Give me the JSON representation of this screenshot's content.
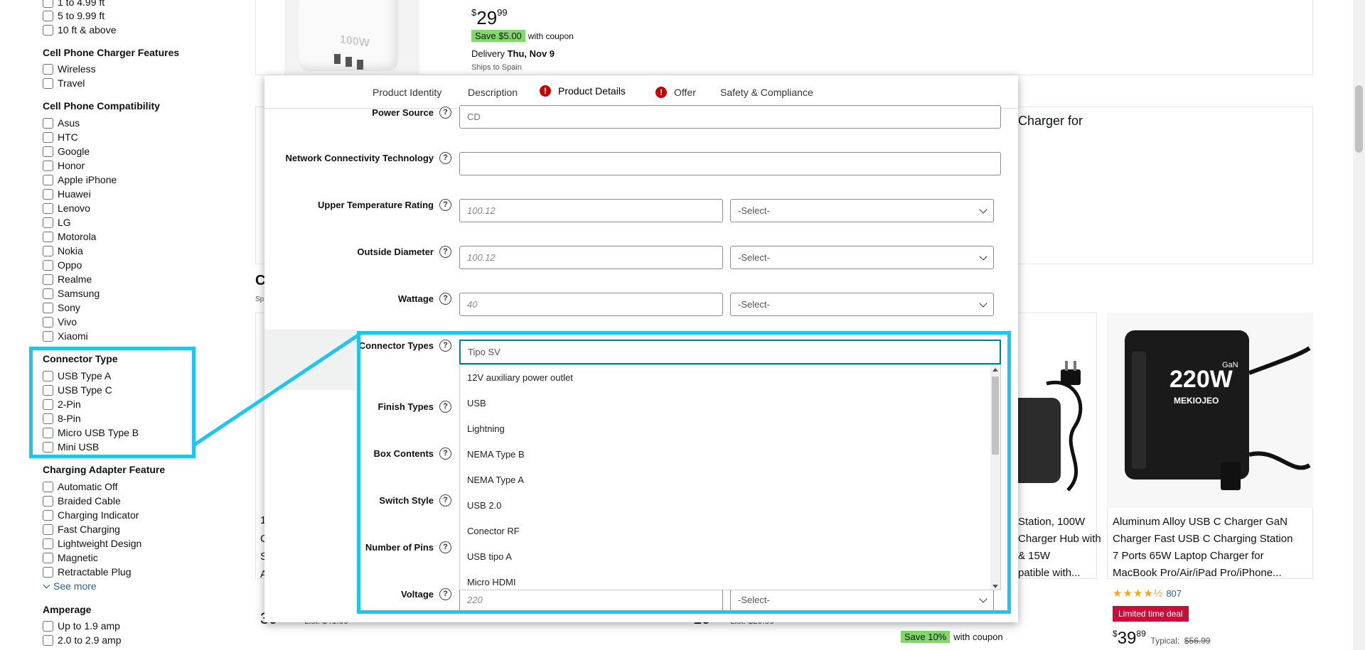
{
  "sidebar": {
    "length_options": [
      "1 to 4.99 ft",
      "5 to 9.99 ft",
      "10 ft & above"
    ],
    "features_heading": "Cell Phone Charger Features",
    "features": [
      "Wireless",
      "Travel"
    ],
    "compat_heading": "Cell Phone Compatibility",
    "compat": [
      "Asus",
      "HTC",
      "Google",
      "Honor",
      "Apple iPhone",
      "Huawei",
      "Lenovo",
      "LG",
      "Motorola",
      "Nokia",
      "Oppo",
      "Realme",
      "Samsung",
      "Sony",
      "Vivo",
      "Xiaomi"
    ],
    "connector_heading": "Connector Type",
    "connector": [
      "USB Type A",
      "USB Type C",
      "2-Pin",
      "8-Pin",
      "Micro USB Type B",
      "Mini USB"
    ],
    "adapter_heading": "Charging Adapter Feature",
    "adapter": [
      "Automatic Off",
      "Braided Cable",
      "Charging Indicator",
      "Fast Charging",
      "Lightweight Design",
      "Magnetic",
      "Retractable Plug"
    ],
    "see_more": "See more",
    "amperage_heading": "Amperage",
    "amperage": [
      "Up to 1.9 amp",
      "2.0 to 2.9 amp"
    ]
  },
  "background": {
    "price_whole": "29",
    "price_cents": "99",
    "price_symbol": "$",
    "save_badge": "Save $5.00",
    "with_coupon": "with coupon",
    "delivery_label": "Delivery",
    "delivery_date": "Thu, Nov 9",
    "ships": "Ships to Spain",
    "charger_for": "Charger for",
    "station_lines": [
      "Station, 100W",
      "Charger Hub with",
      "& 15W",
      "patible with..."
    ],
    "aluminum_title_lines": [
      "Aluminum Alloy USB C Charger GaN",
      "Charger Fast USB C Charging Station",
      "7 Ports 65W Laptop Charger for",
      "MacBook Pro/Air/iPad Pro/iPhone..."
    ],
    "rating_count": "807",
    "deal_badge": "Limited time deal",
    "price2_whole": "39",
    "price2_cents": "89",
    "typical_label": "Typical:",
    "typical_price": "$56.99",
    "save10": "Save 10%",
    "with_coupon2": "with coupon",
    "list_label": "List:",
    "list_price1": "$41.99",
    "list_price2": "$29.99",
    "brand_text": "220W",
    "brand_name": "MEKIOJEO",
    "gan_text": "GaN",
    "cube_text": "100W"
  },
  "modal": {
    "tabs": [
      {
        "label": "Product Identity",
        "alert": false
      },
      {
        "label": "Description",
        "alert": false
      },
      {
        "label": "Product Details",
        "alert": true,
        "active": true
      },
      {
        "label": "Offer",
        "alert": true
      },
      {
        "label": "Safety & Compliance",
        "alert": false
      }
    ],
    "fields": {
      "power_source": {
        "label": "Power Source",
        "value": "CD"
      },
      "network": {
        "label": "Network Connectivity Technology",
        "value": ""
      },
      "upper_temp": {
        "label": "Upper Temperature Rating",
        "placeholder": "100.12",
        "select": "-Select-"
      },
      "outside_diameter": {
        "label": "Outside Diameter",
        "placeholder": "100.12",
        "select": "-Select-"
      },
      "wattage": {
        "label": "Wattage",
        "placeholder": "40",
        "select": "-Select-"
      },
      "connector_types": {
        "label": "Connector Types",
        "value": "Tipo SV"
      },
      "finish_types": {
        "label": "Finish Types"
      },
      "box_contents": {
        "label": "Box Contents"
      },
      "switch_style": {
        "label": "Switch Style"
      },
      "number_of_pins": {
        "label": "Number of Pins"
      },
      "voltage": {
        "label": "Voltage",
        "placeholder": "220",
        "select": "-Select-"
      }
    },
    "dropdown_options": [
      "12V auxiliary power outlet",
      "USB",
      "Lightning",
      "NEMA Type B",
      "NEMA Type A",
      "USB 2.0",
      "Conector RF",
      "USB tipo A",
      "Micro HDMI"
    ]
  },
  "colors": {
    "highlight": "#1ec5ee",
    "accent": "#008296",
    "alert": "#c40000",
    "save_green": "#7fda69",
    "deal_red": "#cc0c39"
  }
}
